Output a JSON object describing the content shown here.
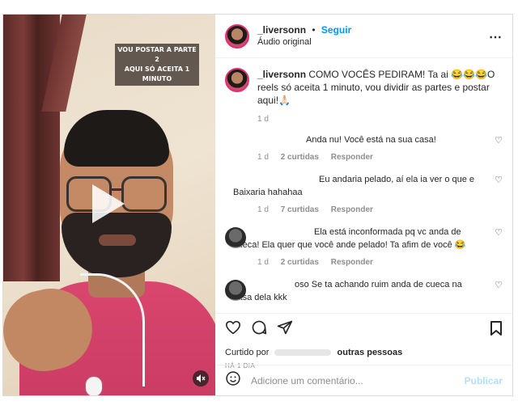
{
  "video": {
    "caption_line1": "VOU POSTAR A PARTE 2",
    "caption_line2": "AQUI SÓ ACEITA 1 MINUTO",
    "play_icon": "play-icon",
    "mute_icon": "speaker-muted-icon"
  },
  "header": {
    "username": "_liversonn",
    "separator": "•",
    "follow_label": "Seguir",
    "audio_label": "Áudio original",
    "more_icon": "⋯"
  },
  "post": {
    "username": "_liversonn",
    "text": "COMO VOCÊS PEDIRAM! Ta ai 😂😂😂O reels só aceita 1 minuto, vou dividir as partes e postar aqui!🙏🏻",
    "time": "1 d"
  },
  "comments": [
    {
      "text": "Anda nu! Você está na sua casa!",
      "time": "1 d",
      "likes": "2 curtidas",
      "reply": "Responder"
    },
    {
      "text": "Eu andaria pelado, aí ela ia ver o que e Baixaria hahahaa",
      "time": "1 d",
      "likes": "7 curtidas",
      "reply": "Responder"
    },
    {
      "text": "Ela está inconformada pq vc anda de cueca! Ela quer que você ande pelado! Ta afim de você 😂",
      "time": "1 d",
      "likes": "2 curtidas",
      "reply": "Responder"
    },
    {
      "text": "oso Se ta achando ruim anda de cueca na casa dela kkk",
      "time": "",
      "likes": "",
      "reply": ""
    }
  ],
  "actions": {
    "liked_prefix": "Curtido por",
    "liked_suffix": "outras pessoas",
    "time_ago": "HÁ 1 DIA"
  },
  "add_comment": {
    "placeholder": "Adicione um comentário...",
    "publish_label": "Publicar"
  },
  "colors": {
    "accent": "#0095f6",
    "muted": "#8e8e8e",
    "publish_disabled": "#b2dffc",
    "shirt": "#d9466e"
  }
}
